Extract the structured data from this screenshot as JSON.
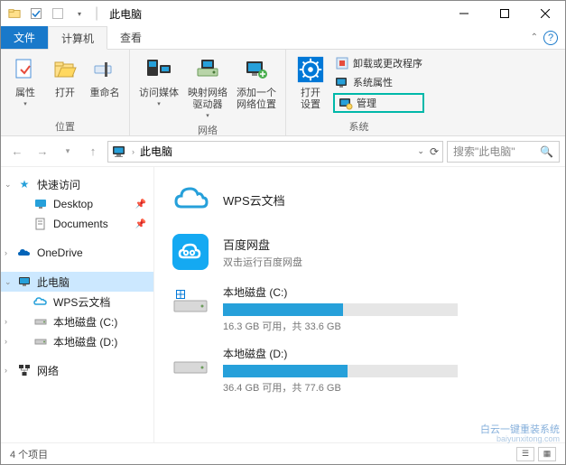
{
  "window": {
    "title": "此电脑"
  },
  "tabs": {
    "file": "文件",
    "computer": "计算机",
    "view": "查看"
  },
  "ribbon": {
    "location": {
      "label": "位置",
      "properties": "属性",
      "open": "打开",
      "rename": "重命名"
    },
    "network": {
      "label": "网络",
      "access_media": "访问媒体",
      "map_drive": "映射网络\n驱动器",
      "add_location": "添加一个\n网络位置"
    },
    "system": {
      "label": "系统",
      "open_settings": "打开\n设置",
      "uninstall": "卸载或更改程序",
      "properties": "系统属性",
      "manage": "管理"
    }
  },
  "addressbar": {
    "location": "此电脑"
  },
  "search": {
    "placeholder": "搜索\"此电脑\""
  },
  "sidebar": {
    "quick_access": "快速访问",
    "desktop": "Desktop",
    "documents": "Documents",
    "onedrive": "OneDrive",
    "this_pc": "此电脑",
    "wps": "WPS云文档",
    "drive_c": "本地磁盘 (C:)",
    "drive_d": "本地磁盘 (D:)",
    "network": "网络"
  },
  "content": {
    "wps": {
      "title": "WPS云文档"
    },
    "baidu": {
      "title": "百度网盘",
      "sub": "双击运行百度网盘"
    },
    "drive_c": {
      "name": "本地磁盘 (C:)",
      "stats": "16.3 GB 可用，共 33.6 GB",
      "fill_pct": 51
    },
    "drive_d": {
      "name": "本地磁盘 (D:)",
      "stats": "36.4 GB 可用，共 77.6 GB",
      "fill_pct": 53
    }
  },
  "statusbar": {
    "count": "4 个项目"
  },
  "watermark": {
    "line1": "白云一键重装系统",
    "line2": "baiyunxitong.com"
  }
}
